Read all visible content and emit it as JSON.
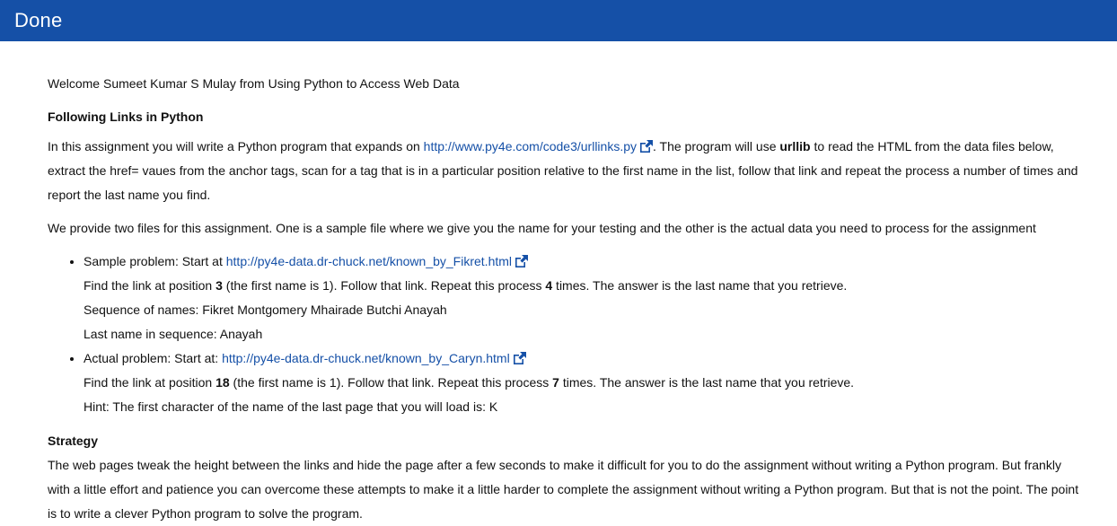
{
  "header": {
    "title": "Done"
  },
  "welcome": "Welcome Sumeet Kumar S Mulay from Using Python to Access Web Data",
  "heading": "Following Links in Python",
  "intro": {
    "pre": "In this assignment you will write a Python program that expands on ",
    "link": "http://www.py4e.com/code3/urllinks.py",
    "mid": ". The program will use ",
    "bold": "urllib",
    "post": " to read the HTML from the data files below, extract the href= vaues from the anchor tags, scan for a tag that is in a particular position relative to the first name in the list, follow that link and repeat the process a number of times and report the last name you find."
  },
  "provide": "We provide two files for this assignment. One is a sample file where we give you the name for your testing and the other is the actual data you need to process for the assignment",
  "sample": {
    "start": "Sample problem: Start at ",
    "link": "http://py4e-data.dr-chuck.net/known_by_Fikret.html",
    "find_pre": "Find the link at position ",
    "position": "3",
    "find_mid": " (the first name is 1). Follow that link. Repeat this process ",
    "count": "4",
    "find_post": " times. The answer is the last name that you retrieve.",
    "sequence": "Sequence of names: Fikret Montgomery Mhairade Butchi Anayah",
    "last": "Last name in sequence: Anayah"
  },
  "actual": {
    "start": "Actual problem: Start at: ",
    "link": "http://py4e-data.dr-chuck.net/known_by_Caryn.html",
    "find_pre": "Find the link at position ",
    "position": "18",
    "find_mid": " (the first name is 1). Follow that link. Repeat this process ",
    "count": "7",
    "find_post": " times. The answer is the last name that you retrieve.",
    "hint": "Hint: The first character of the name of the last page that you will load is: K"
  },
  "strategy": {
    "heading": "Strategy",
    "text": "The web pages tweak the height between the links and hide the page after a few seconds to make it difficult for you to do the assignment without writing a Python program. But frankly with a little effort and patience you can overcome these attempts to make it a little harder to complete the assignment without writing a Python program. But that is not the point. The point is to write a clever Python program to solve the program."
  },
  "colors": {
    "header_bg": "#1550a7",
    "link": "#1550a7"
  },
  "icons": {
    "external": "external-link-icon"
  }
}
